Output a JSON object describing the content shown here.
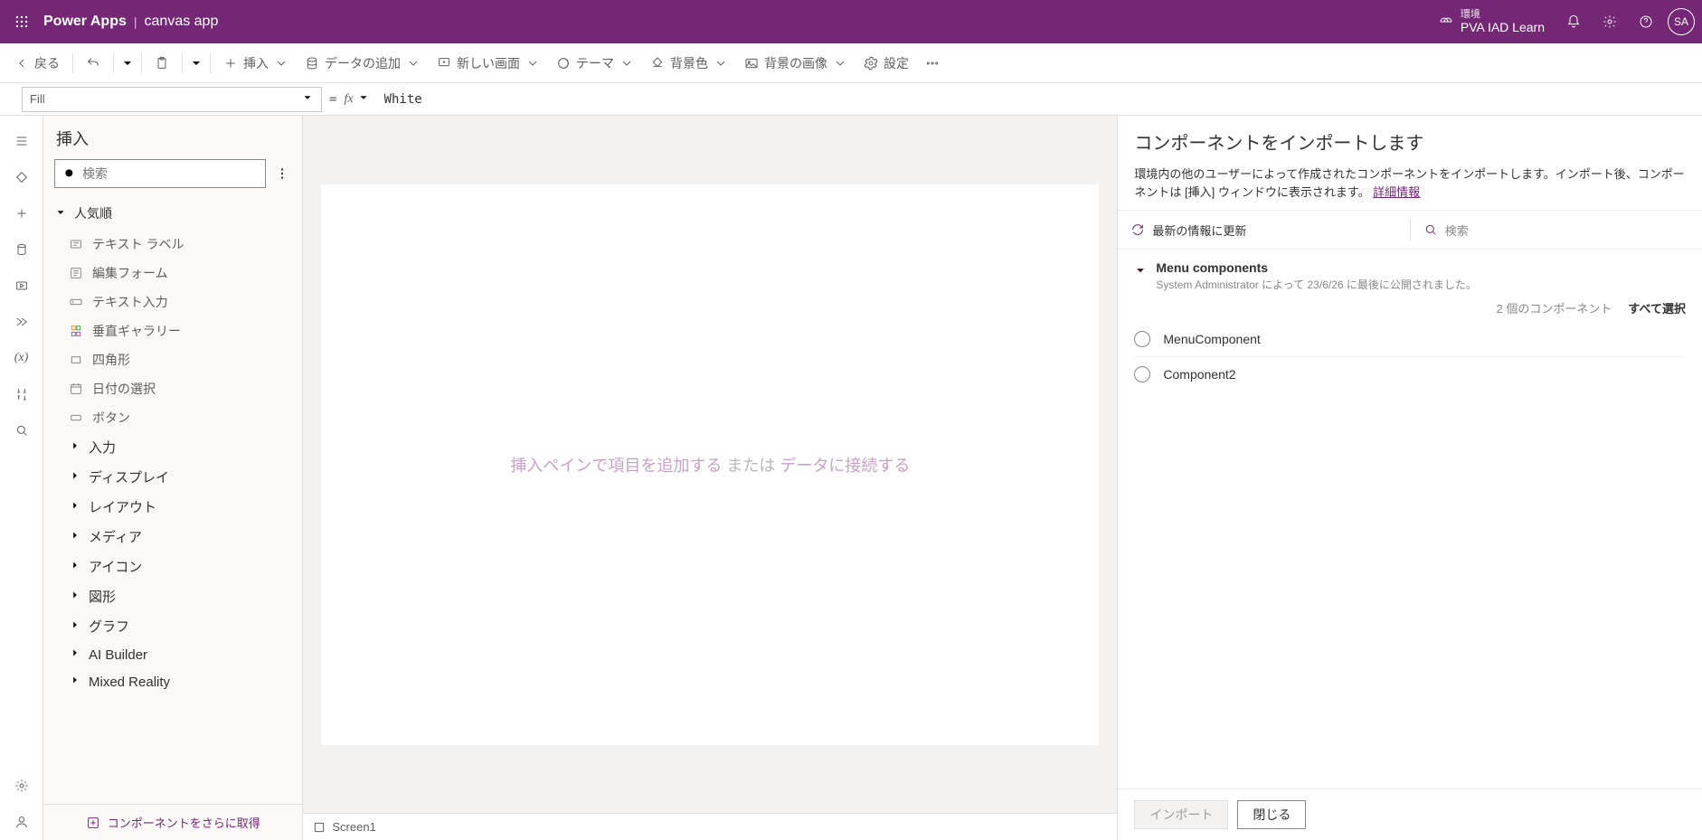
{
  "header": {
    "brand": "Power Apps",
    "app_name": "canvas app",
    "env_label": "環境",
    "env_name": "PVA IAD Learn",
    "avatar": "SA"
  },
  "cmd": {
    "back": "戻る",
    "insert": "挿入",
    "add_data": "データの追加",
    "new_screen": "新しい画面",
    "theme": "テーマ",
    "bg_color": "背景色",
    "bg_image": "背景の画像",
    "settings": "設定"
  },
  "fx": {
    "property": "Fill",
    "value": "White"
  },
  "insert_panel": {
    "title": "挿入",
    "search_ph": "検索",
    "popular": "人気順",
    "items": {
      "text_label": "テキスト ラベル",
      "edit_form": "編集フォーム",
      "text_input": "テキスト入力",
      "vertical_gallery": "垂直ギャラリー",
      "rectangle": "四角形",
      "date_picker": "日付の選択",
      "button": "ボタン"
    },
    "cats": {
      "input": "入力",
      "display": "ディスプレイ",
      "layout": "レイアウト",
      "media": "メディア",
      "icons": "アイコン",
      "shapes": "図形",
      "charts": "グラフ",
      "ai": "AI Builder",
      "mr": "Mixed Reality"
    },
    "footer": "コンポーネントをさらに取得"
  },
  "canvas": {
    "empty_add": "挿入ペインで項目を追加する",
    "empty_or": "または",
    "empty_data": "データに接続する",
    "screen": "Screen1"
  },
  "import": {
    "title": "コンポーネントをインポートします",
    "desc": "環境内の他のユーザーによって作成されたコンポーネントをインポートします。インポート後、コンポーネントは [挿入] ウィンドウに表示されます。",
    "details_link": "詳細情報",
    "refresh": "最新の情報に更新",
    "search_ph": "検索",
    "group_title": "Menu components",
    "group_sub": "System Administrator によって 23/6/26 に最後に公開されました。",
    "count": "2 個のコンポーネント",
    "select_all": "すべて選択",
    "comp1": "MenuComponent",
    "comp2": "Component2",
    "btn_import": "インポート",
    "btn_close": "閉じる"
  }
}
